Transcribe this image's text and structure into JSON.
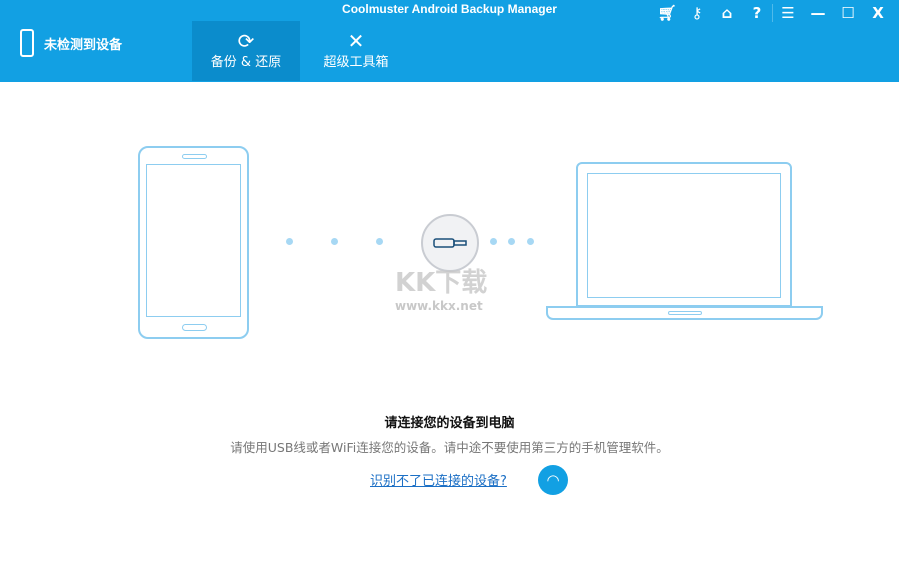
{
  "header": {
    "title": "Coolmuster Android Backup Manager",
    "device_status": "未检测到设备",
    "tabs": [
      {
        "label": "备份 & 还原",
        "active": true
      },
      {
        "label": "超级工具箱",
        "active": false
      }
    ],
    "controls": [
      "cart-icon",
      "key-icon",
      "home-icon",
      "help-icon",
      "feedback-icon",
      "minimize",
      "maximize",
      "close"
    ]
  },
  "main": {
    "heading": "请连接您的设备到电脑",
    "instruction": "请使用USB线或者WiFi连接您的设备。请中途不要使用第三方的手机管理软件。",
    "help_link": "识别不了已连接的设备?",
    "watermark": "KK下载",
    "watermark_url": "www.kkx.net"
  },
  "colors": {
    "accent": "#12a0e3",
    "active_tab": "#0b8ccc",
    "link": "#1b6fc5"
  }
}
